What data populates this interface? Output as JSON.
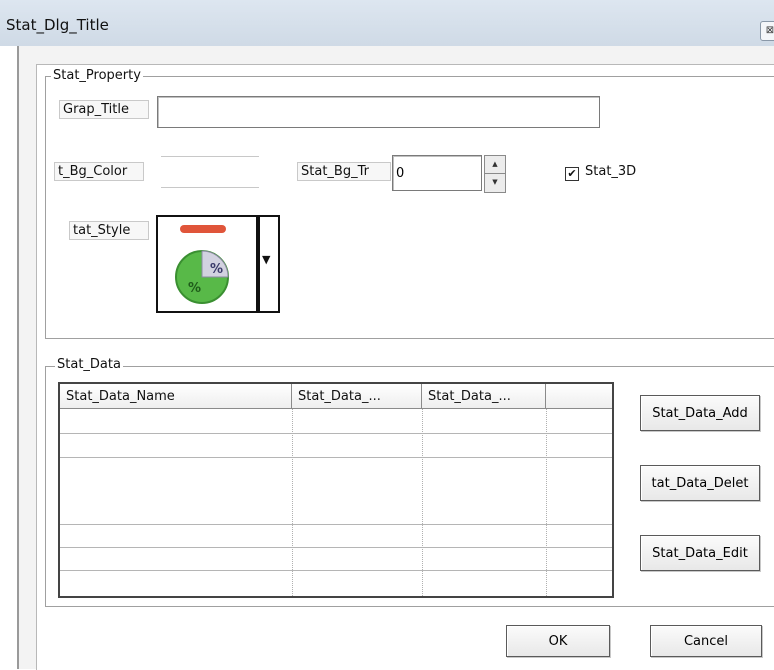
{
  "window": {
    "title": "Stat_Dlg_Title",
    "close_glyph": "⊠"
  },
  "property_group": {
    "label": "Stat_Property",
    "graph_title_label": "Grap_Title",
    "graph_title_value": "",
    "bg_color_label": "t_Bg_Color",
    "bg_trans_label": "Stat_Bg_Tr",
    "bg_trans_value": "0",
    "stat_3d_label": "Stat_3D",
    "stat_3d_checked": true,
    "style_label": "tat_Style"
  },
  "data_group": {
    "label": "Stat_Data",
    "columns": [
      "Stat_Data_Name",
      "Stat_Data_...",
      "Stat_Data_...",
      ""
    ],
    "rows": [
      [
        "",
        "",
        "",
        ""
      ],
      [
        "",
        "",
        "",
        ""
      ],
      [
        "",
        "",
        "",
        ""
      ],
      [
        "",
        "",
        "",
        ""
      ],
      [
        "",
        "",
        "",
        ""
      ],
      [
        "",
        "",
        "",
        ""
      ]
    ],
    "add_button": "Stat_Data_Add",
    "delete_button": "tat_Data_Delet",
    "edit_button": "Stat_Data_Edit"
  },
  "footer": {
    "ok_label": "OK",
    "cancel_label": "Cancel"
  },
  "icons": {
    "chart_style": "pie-percent-icon",
    "check": "✔",
    "spin_up": "▲",
    "spin_down": "▼",
    "dropdown": "▼"
  },
  "colors": {
    "pie_green": "#58b948",
    "pie_bar_red": "#e0553a",
    "pie_slice": "#c6c6d6"
  }
}
